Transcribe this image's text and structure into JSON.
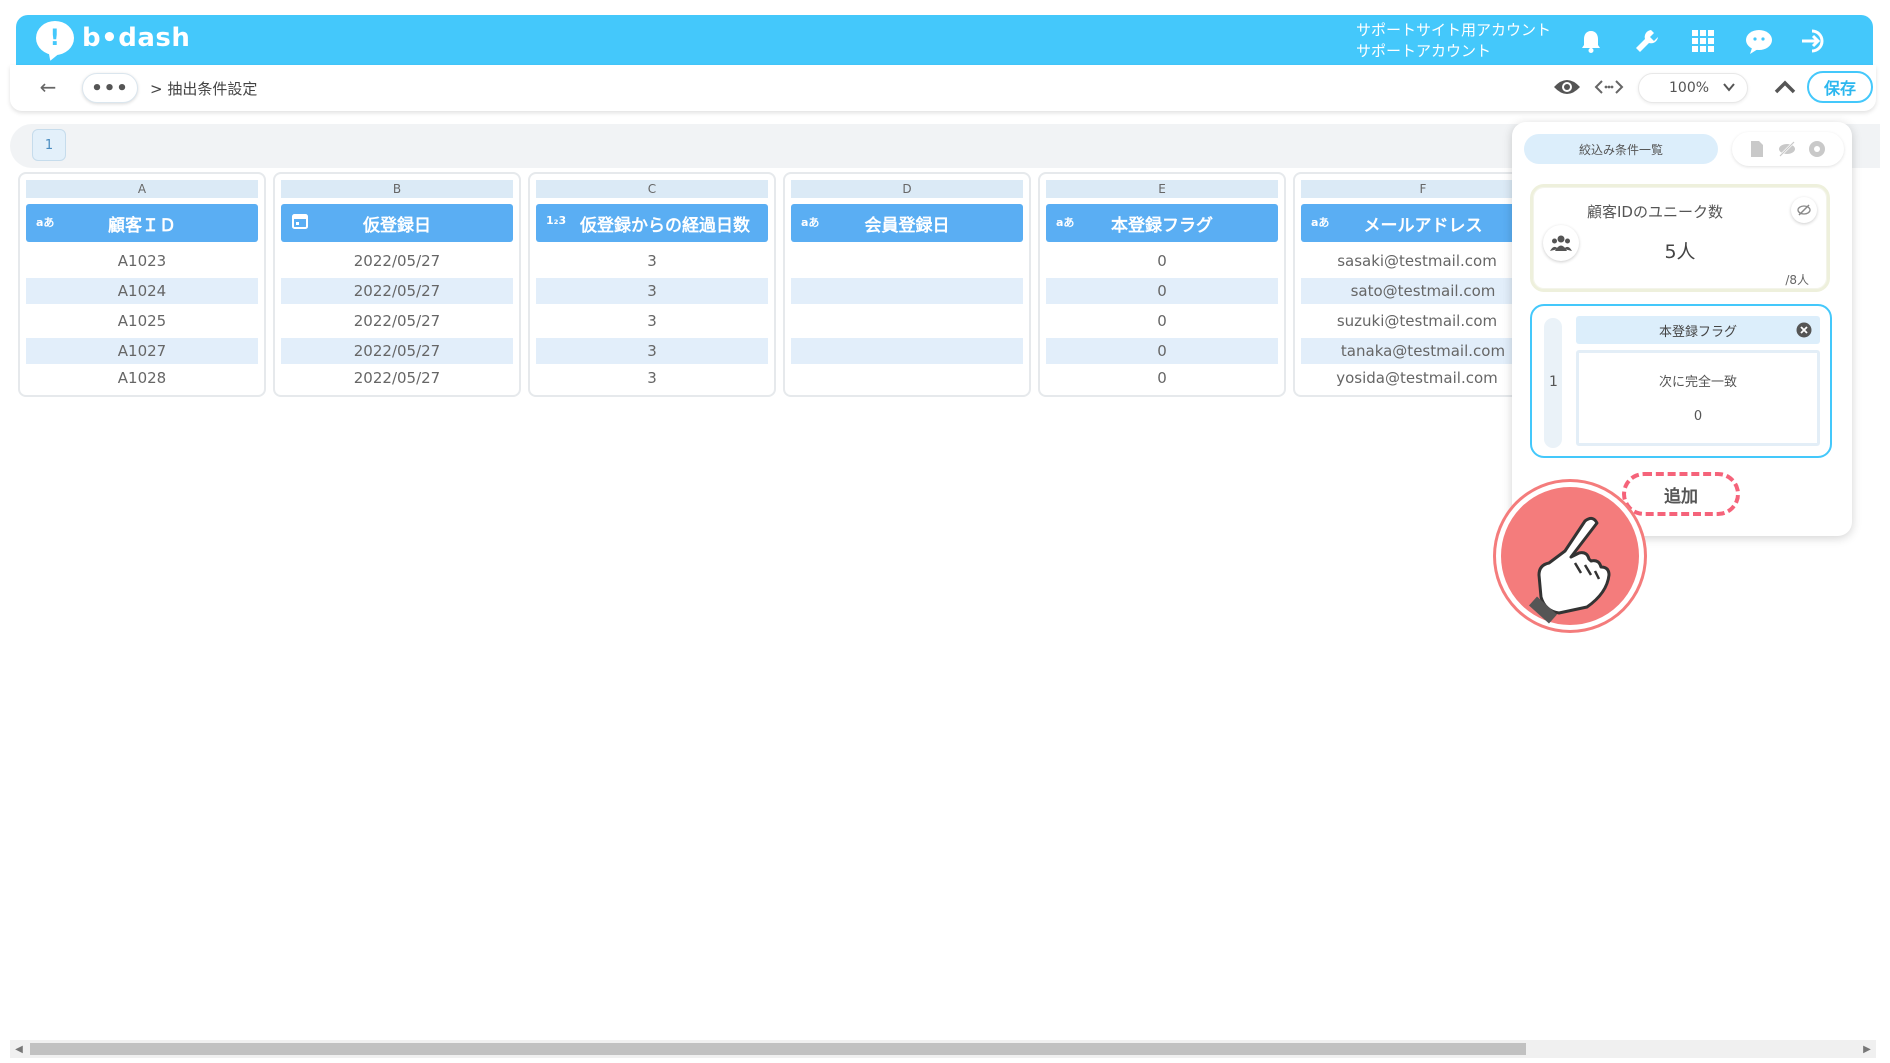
{
  "header": {
    "logo_text": "b•dash",
    "account_line1": "サポートサイト用アカウント",
    "account_line2": "サポートアカウント",
    "icons": [
      "bell-icon",
      "wrench-icon",
      "grid-icon",
      "chat-icon",
      "logout-icon"
    ]
  },
  "toolbar": {
    "back_label": "←",
    "more_label": "•••",
    "breadcrumb": "> 抽出条件設定",
    "zoom": "100%",
    "save_label": "保存"
  },
  "sheet_tab": "1",
  "columns": [
    {
      "letter": "A",
      "type_icon": "text-type-icon",
      "type_label": "aあ",
      "header": "顧客ＩＤ",
      "cells": [
        "A1023",
        "A1024",
        "A1025",
        "A1027",
        "A1028"
      ]
    },
    {
      "letter": "B",
      "type_icon": "calendar-icon",
      "type_label": "",
      "header": "仮登録日",
      "cells": [
        "2022/05/27",
        "2022/05/27",
        "2022/05/27",
        "2022/05/27",
        "2022/05/27"
      ]
    },
    {
      "letter": "C",
      "type_icon": "number-type-icon",
      "type_label": "1₂3",
      "header": "仮登録からの経過日数",
      "cells": [
        "3",
        "3",
        "3",
        "3",
        "3"
      ]
    },
    {
      "letter": "D",
      "type_icon": "text-type-icon",
      "type_label": "aあ",
      "header": "会員登録日",
      "cells": [
        "",
        "",
        "",
        "",
        ""
      ]
    },
    {
      "letter": "E",
      "type_icon": "text-type-icon",
      "type_label": "aあ",
      "header": "本登録フラグ",
      "cells": [
        "0",
        "0",
        "0",
        "0",
        "0"
      ]
    },
    {
      "letter": "F",
      "type_icon": "text-type-icon",
      "type_label": "aあ",
      "header": "メールアドレス",
      "cells": [
        "sasaki@testmail.com",
        "sato@testmail.com",
        "suzuki@testmail.com",
        "tanaka@testmail.com",
        "yosida@testmail.com"
      ]
    }
  ],
  "panel": {
    "tab_label": "絞込み条件一覧",
    "unique": {
      "title": "顧客IDのユニーク数",
      "count": "5人",
      "total": "/8人"
    },
    "condition": {
      "index": "1",
      "column": "本登録フラグ",
      "operator": "次に完全一致",
      "value": "0"
    },
    "add_label": "追加"
  },
  "colors": {
    "header_bg": "#44c8fb",
    "column_header_bg": "#5aaef3",
    "stripe": "#e2eefa",
    "add_border": "#f5637a"
  }
}
